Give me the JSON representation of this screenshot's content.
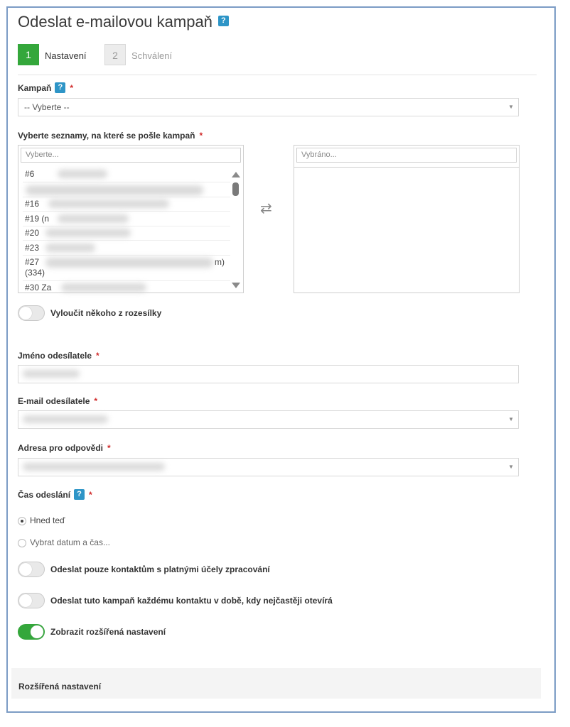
{
  "page": {
    "title": "Odeslat e-mailovou kampaň",
    "help_glyph": "?"
  },
  "steps": [
    {
      "number": "1",
      "label": "Nastavení"
    },
    {
      "number": "2",
      "label": "Schválení"
    }
  ],
  "campaign": {
    "label": "Kampaň",
    "required": "*",
    "value": "-- Vyberte --"
  },
  "lists": {
    "label": "Vyberte seznamy, na které se pošle kampaň",
    "required": "*",
    "available_placeholder": "Vyberte...",
    "selected_placeholder": "Vybráno...",
    "items": [
      {
        "text": "#6"
      },
      {
        "text": ""
      },
      {
        "text": "#16"
      },
      {
        "text": "#19 (n"
      },
      {
        "text": "#20"
      },
      {
        "text": "#23"
      },
      {
        "text": "#27",
        "suffix": "m)",
        "line2": "(334)"
      },
      {
        "text": "#30 Za"
      }
    ],
    "transfer_glyph": "⇄"
  },
  "exclude": {
    "label": "Vyloučit někoho z rozesílky",
    "on": false
  },
  "sender_name": {
    "label": "Jméno odesílatele",
    "required": "*"
  },
  "sender_email": {
    "label": "E-mail odesílatele",
    "required": "*"
  },
  "reply_to": {
    "label": "Adresa pro odpovědi",
    "required": "*"
  },
  "send_time": {
    "label": "Čas odeslání",
    "required": "*",
    "options": [
      {
        "label": "Hned teď",
        "checked": true
      },
      {
        "label": "Vybrat datum a čas...",
        "checked": false
      }
    ]
  },
  "toggles": [
    {
      "label": "Odeslat pouze kontaktům s platnými účely zpracování",
      "on": false
    },
    {
      "label": "Odeslat tuto kampaň každému kontaktu v době, kdy nejčastěji otevírá",
      "on": false
    },
    {
      "label": "Zobrazit rozšířená nastavení",
      "on": true
    }
  ],
  "advanced": {
    "label": "Rozšířená nastavení"
  },
  "colors": {
    "accent_green": "#34a73b",
    "help_blue": "#2e95c7",
    "required_red": "#d02a2a",
    "frame_blue": "#7c9cc5"
  }
}
